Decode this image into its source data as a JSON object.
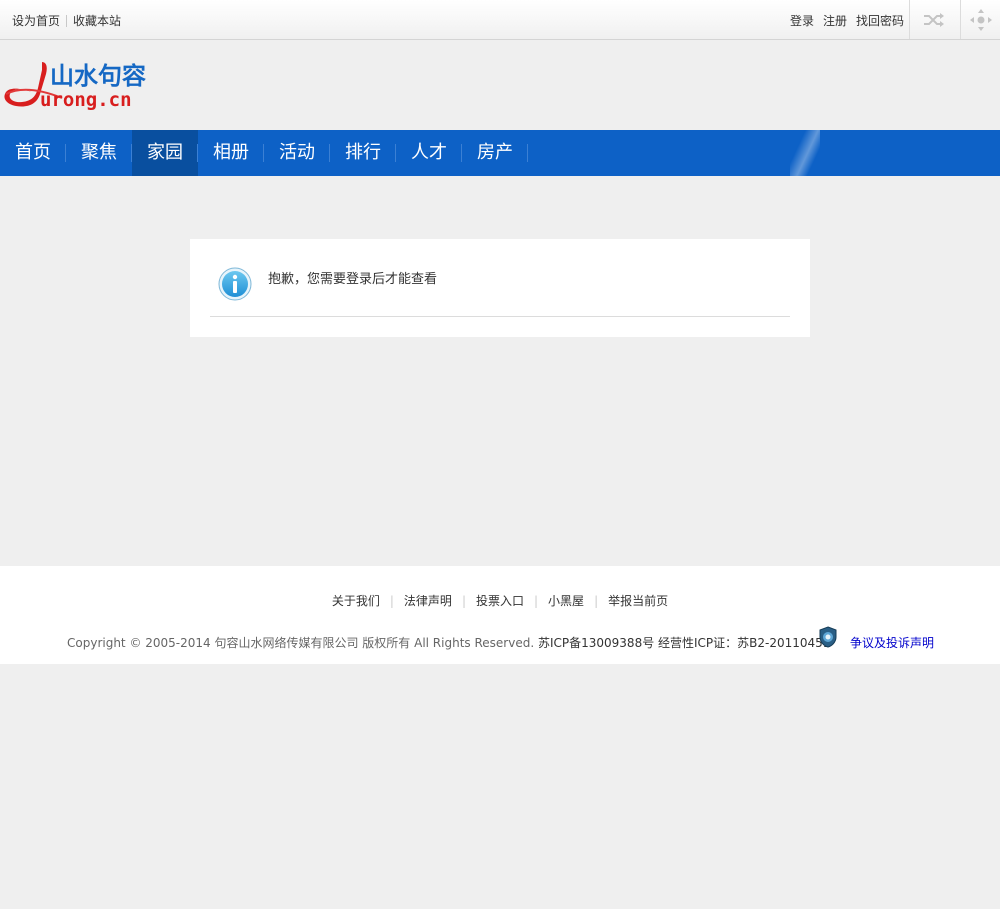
{
  "topbar": {
    "set_home": "设为首页",
    "bookmark": "收藏本站",
    "login": "登录",
    "register": "注册",
    "find_password": "找回密码",
    "shuffle_icon": "shuffle-icon",
    "nav_icon": "navigation-arrows-icon"
  },
  "logo": {
    "chinese": "山水句容",
    "latin": "urong.cn"
  },
  "nav": {
    "items": [
      "首页",
      "聚焦",
      "家园",
      "相册",
      "活动",
      "排行",
      "人才",
      "房产"
    ],
    "active": "家园",
    "color": "#0d61c6"
  },
  "message": {
    "text": "抱歉，您需要登录后才能查看",
    "icon": "info-icon"
  },
  "footer": {
    "links": [
      "关于我们",
      "法律声明",
      "投票入口",
      "小黑屋",
      "举报当前页"
    ],
    "copyright": "Copyright © 2005-2014 句容山水网络传媒有限公司 版权所有 All Rights Reserved.",
    "icp": "苏ICP备13009388号 经营性ICP证：苏B2-20110451",
    "complaint": "争议及投诉声明",
    "badge_icon": "police-badge-icon"
  }
}
